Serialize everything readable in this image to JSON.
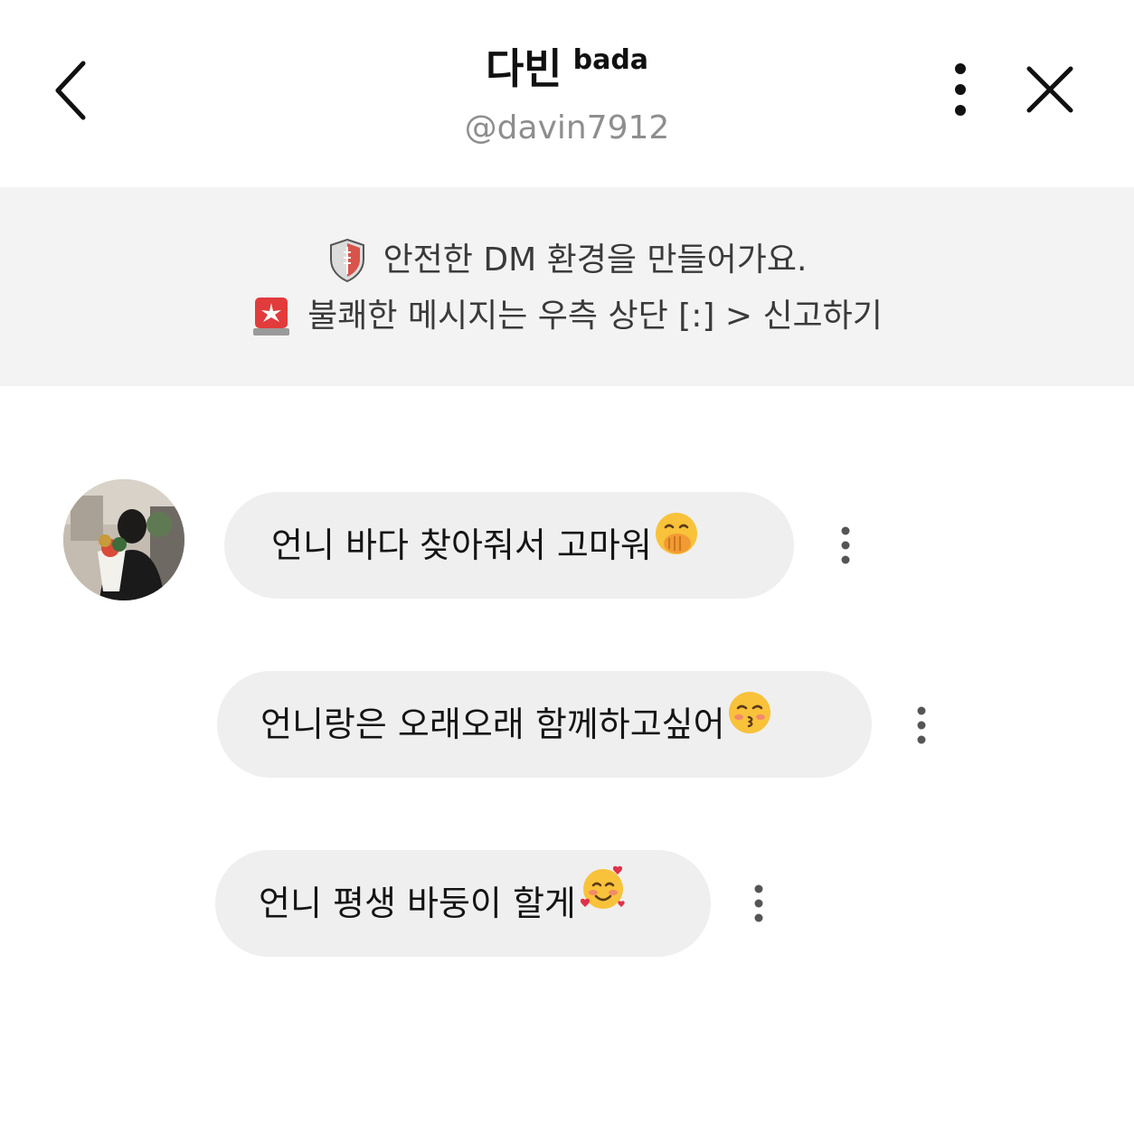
{
  "header": {
    "name": "다빈",
    "tag": "bada",
    "handle": "@davin7912",
    "back_icon": "chevron-left-icon",
    "more_icon": "more-vertical-icon",
    "close_icon": "close-icon"
  },
  "notice": {
    "line1": "안전한 DM 환경을 만들어가요.",
    "line1_icon": "shield-icon",
    "line2": "불쾌한 메시지는 우측 상단 [:] > 신고하기",
    "line2_icon": "siren-icon"
  },
  "messages": [
    {
      "text": "언니 바다 찾아줘서 고마워",
      "emoji": "hand-over-mouth-emoji"
    },
    {
      "text": "언니랑은 오래오래 함께하고싶어",
      "emoji": "kissing-face-emoji"
    },
    {
      "text": "언니 평생 바둥이 할게",
      "emoji": "smiling-face-with-hearts-emoji"
    }
  ],
  "colors": {
    "bubble": "#efefef",
    "notice_bg": "#f3f3f3",
    "handle": "#8e8e8e"
  }
}
